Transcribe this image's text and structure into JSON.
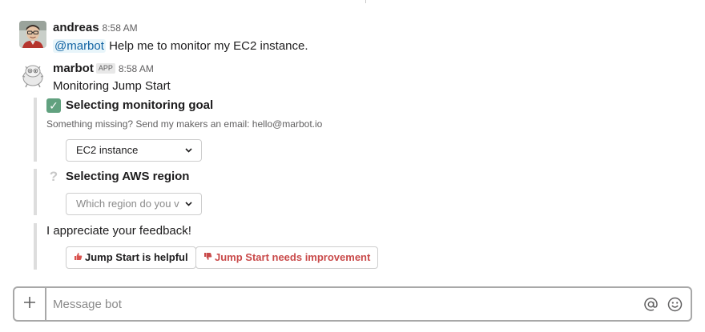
{
  "messages": [
    {
      "author": "andreas",
      "time": "8:58 AM",
      "mention": "@marbot",
      "text": "Help me to monitor my EC2 instance."
    },
    {
      "author": "marbot",
      "badge": "APP",
      "time": "8:58 AM",
      "text": "Monitoring Jump Start"
    }
  ],
  "attachments": {
    "goal": {
      "icon": "check-mark-icon",
      "icon_glyph": "✓",
      "title": "Selecting monitoring goal",
      "subtitle": "Something missing? Send my makers an email: hello@marbot.io",
      "select_value": "EC2 instance"
    },
    "region": {
      "icon": "question-mark-icon",
      "icon_glyph": "?",
      "title": "Selecting AWS region",
      "select_placeholder": "Which region do you v"
    },
    "feedback": {
      "text": "I appreciate your feedback!",
      "good_label": "Jump Start is helpful",
      "bad_label": "Jump Start needs improvement"
    }
  },
  "composer": {
    "placeholder": "Message bot"
  },
  "colors": {
    "accent_link": "#1264a3",
    "check_green": "#61a17f",
    "danger": "#c94a4a",
    "attachment_bar": "#dddddd"
  }
}
